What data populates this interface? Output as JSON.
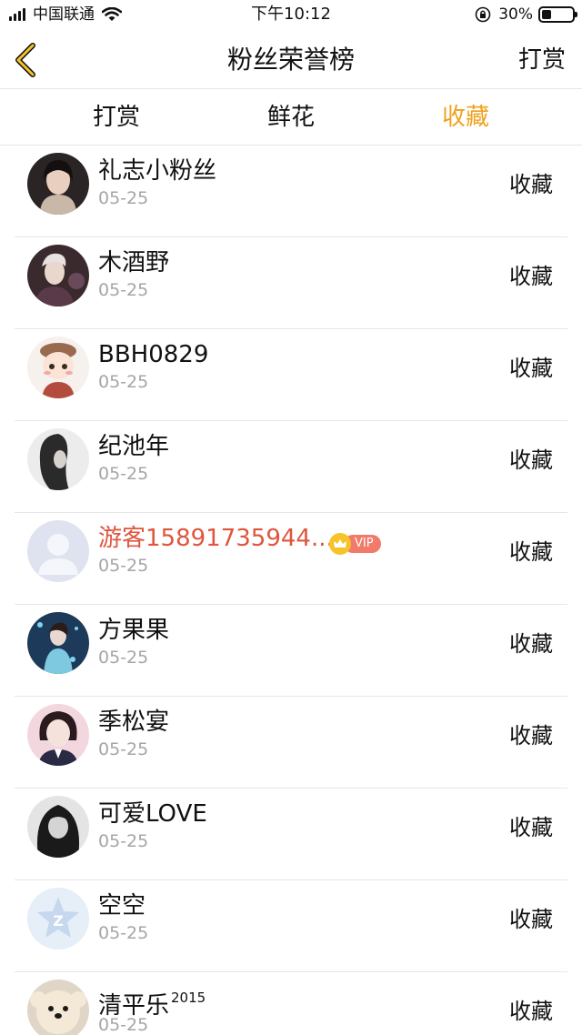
{
  "status_bar": {
    "carrier": "中国联通",
    "time": "下午10:12",
    "battery_percent": "30%",
    "battery_level": 0.3,
    "icons": [
      "signal-icon",
      "wifi-icon",
      "orientation-lock-icon",
      "battery-icon"
    ]
  },
  "nav": {
    "back_icon": "chevron-left-icon",
    "title": "粉丝荣誉榜",
    "right_label": "打赏"
  },
  "tabs": [
    {
      "label": "打赏",
      "active": false
    },
    {
      "label": "鲜花",
      "active": false
    },
    {
      "label": "收藏",
      "active": true
    }
  ],
  "colors": {
    "accent": "#f0a21e",
    "vip_name": "#e0553d",
    "vip_badge": "#f27a6a",
    "crown": "#f6c428",
    "date": "#a6a6a6",
    "divider": "#e6e6e6"
  },
  "list": [
    {
      "name": "礼志小粉丝",
      "date": "05-25",
      "action": "收藏"
    },
    {
      "name": "木酒野",
      "date": "05-25",
      "action": "收藏"
    },
    {
      "name": "BBH0829",
      "date": "05-25",
      "action": "收藏"
    },
    {
      "name": "纪池年",
      "date": "05-25",
      "action": "收藏"
    },
    {
      "name": "游客15891735944...",
      "date": "05-25",
      "action": "收藏",
      "vip": "VIP"
    },
    {
      "name": "方果果",
      "date": "05-25",
      "action": "收藏"
    },
    {
      "name": "季松宴",
      "date": "05-25",
      "action": "收藏"
    },
    {
      "name": "可爱LOVE",
      "date": "05-25",
      "action": "收藏"
    },
    {
      "name": "空空",
      "date": "05-25",
      "action": "收藏"
    },
    {
      "name": "清平乐",
      "name_sup": "2015",
      "date": "05-25",
      "action": "收藏"
    }
  ]
}
